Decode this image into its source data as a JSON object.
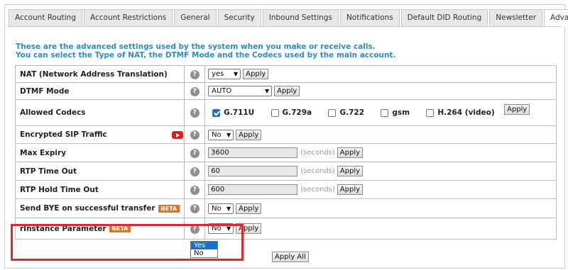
{
  "tabs": [
    "Account Routing",
    "Account Restrictions",
    "General",
    "Security",
    "Inbound Settings",
    "Notifications",
    "Default DID Routing",
    "Newsletter",
    "Advanced"
  ],
  "active_tab": "Advanced",
  "intro": {
    "line1": "These are the advanced settings used by the system when you make or receive calls.",
    "line2": "You can select the Type of NAT, the DTMF Mode and the Codecs used by the main account."
  },
  "labels": {
    "apply": "Apply",
    "apply_all": "Apply All",
    "seconds": "(seconds)",
    "beta": "BETA",
    "help": "?"
  },
  "settings": {
    "nat": {
      "label": "NAT (Network Address Translation)",
      "value": "yes"
    },
    "dtmf": {
      "label": "DTMF Mode",
      "value": "AUTO"
    },
    "codecs": {
      "label": "Allowed Codecs",
      "items": [
        {
          "name": "G.711U",
          "checked": true
        },
        {
          "name": "G.729a",
          "checked": false
        },
        {
          "name": "G.722",
          "checked": false
        },
        {
          "name": "gsm",
          "checked": false
        },
        {
          "name": "H.264 (video)",
          "checked": false
        }
      ]
    },
    "encrypted": {
      "label": "Encrypted SIP Traffic",
      "value": "No"
    },
    "max_expiry": {
      "label": "Max Expiry",
      "value": "3600"
    },
    "rtp_timeout": {
      "label": "RTP Time Out",
      "value": "60"
    },
    "rtp_hold": {
      "label": "RTP Hold Time Out",
      "value": "600"
    },
    "send_bye": {
      "label": "Send BYE on successful transfer",
      "value": "No"
    },
    "rinstance": {
      "label": "rInstance Parameter",
      "value": "No",
      "options": [
        "Yes",
        "No"
      ],
      "highlighted_option": "Yes"
    }
  },
  "colors": {
    "intro": "#2a8ec4",
    "beta": "#e8731f",
    "highlight": "#e3262e",
    "selected": "#1a6fd1"
  }
}
